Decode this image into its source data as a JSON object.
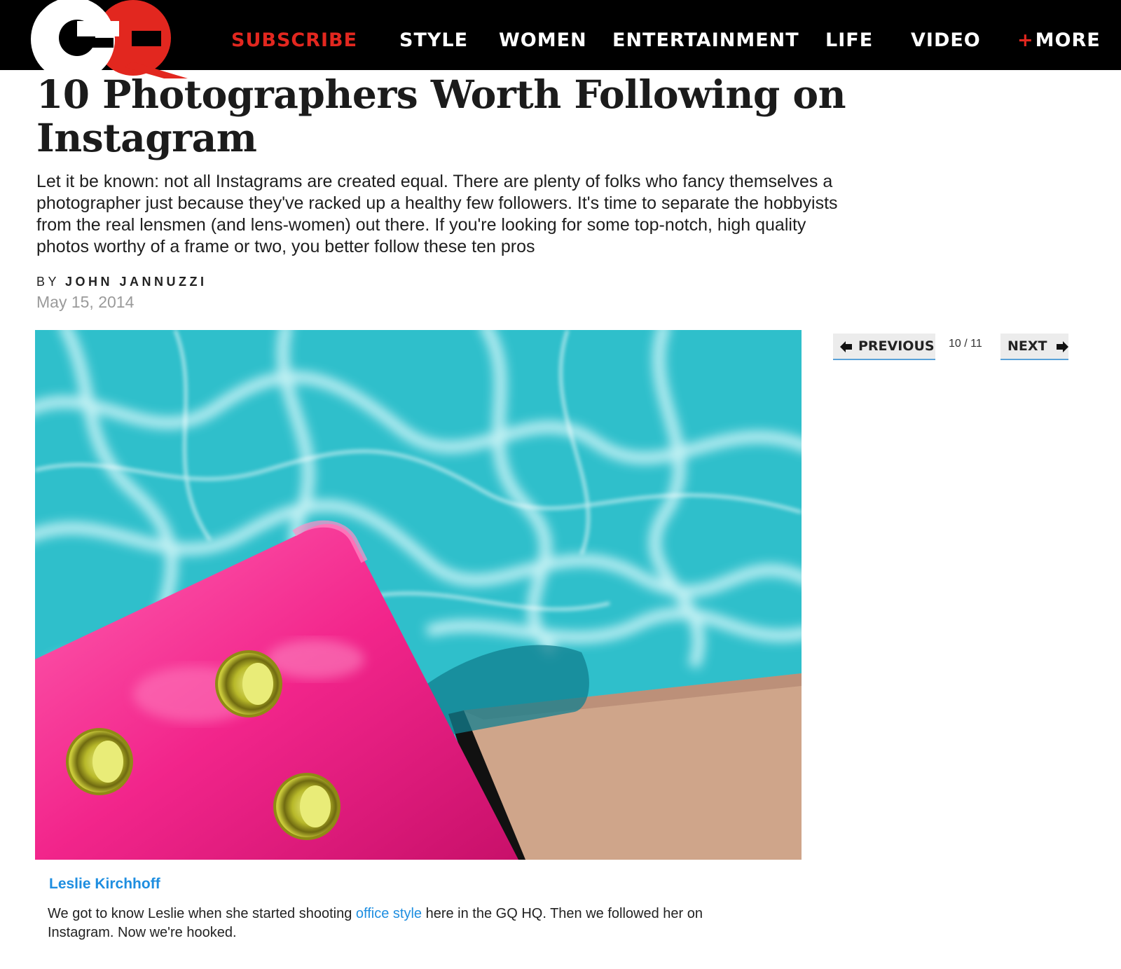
{
  "brand": {
    "logo_text": "GQ",
    "colors": {
      "nav_bg": "#000000",
      "accent_red": "#e2271f",
      "link_blue": "#1e8ee0"
    }
  },
  "nav": {
    "subscribe": "SUBSCRIBE",
    "items": [
      "STYLE",
      "WOMEN",
      "ENTERTAINMENT",
      "LIFE",
      "VIDEO"
    ],
    "more_plus": "+",
    "more": "MORE"
  },
  "article": {
    "headline": "10 Photographers Worth Following on Instagram",
    "dek": "Let it be known: not all Instagrams are created equal. There are plenty of folks who fancy themselves a photographer just because they've racked up a healthy few followers. It's time to separate the hobbyists from the real lensmen (and lens-women) out there. If you're looking for some top-notch, high quality photos worthy of a frame or two, you better follow these ten pros",
    "by_label": "BY",
    "author": "JOHN JANNUZZI",
    "date": "May 15, 2014"
  },
  "pager": {
    "previous": "PREVIOUS",
    "next": "NEXT",
    "count": "10 / 11",
    "current": 10,
    "total": 11
  },
  "slide": {
    "credit": "Leslie Kirchhoff",
    "caption_before": "We got to know Leslie when she started shooting ",
    "caption_link": "office style",
    "caption_after": " here in the GQ HQ. Then we followed her on Instagram. Now we're hooked."
  }
}
